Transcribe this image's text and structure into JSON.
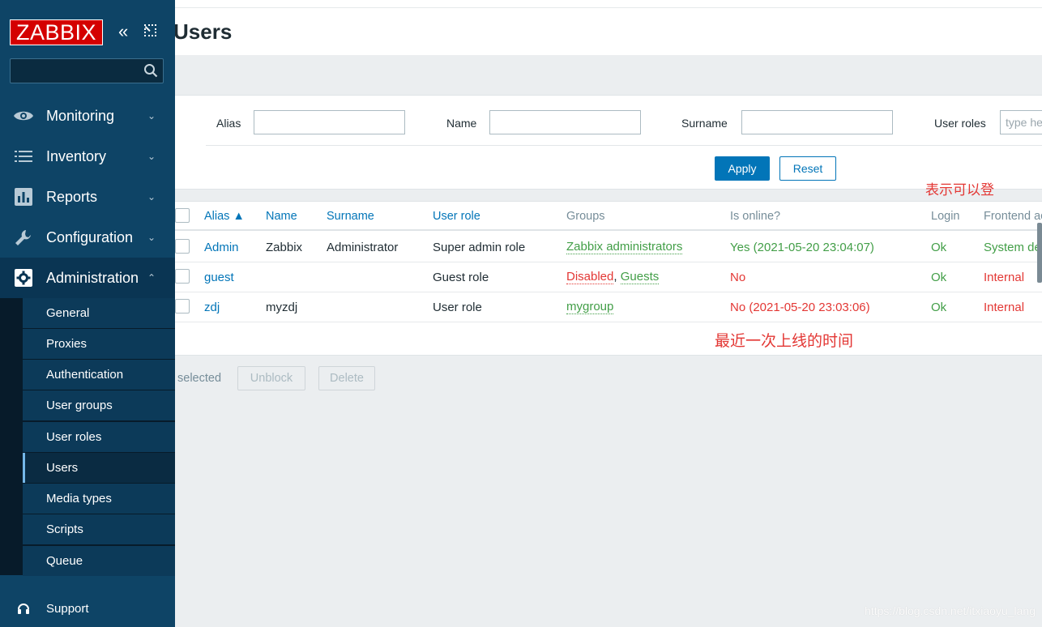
{
  "brand": {
    "logo_text": "ZABBIX",
    "logo_color": "#d40000"
  },
  "sidebar": {
    "search_placeholder": "",
    "menu": [
      {
        "label": "Monitoring",
        "icon": "eye-icon"
      },
      {
        "label": "Inventory",
        "icon": "list-icon"
      },
      {
        "label": "Reports",
        "icon": "bar-chart-icon"
      },
      {
        "label": "Configuration",
        "icon": "wrench-icon"
      },
      {
        "label": "Administration",
        "icon": "gear-icon"
      }
    ],
    "submenu": [
      "General",
      "Proxies",
      "Authentication",
      "User groups",
      "User roles",
      "Users",
      "Media types",
      "Scripts",
      "Queue"
    ],
    "support_label": "Support"
  },
  "page": {
    "title": "Users"
  },
  "filter": {
    "alias_label": "Alias",
    "name_label": "Name",
    "surname_label": "Surname",
    "user_roles_label": "User roles",
    "user_roles_placeholder": "type here to search",
    "alias_value": "",
    "name_value": "",
    "surname_value": "",
    "apply_label": "Apply",
    "reset_label": "Reset"
  },
  "table": {
    "headers": {
      "alias": "Alias ▲",
      "name": "Name",
      "surname": "Surname",
      "user_role": "User role",
      "groups": "Groups",
      "is_online": "Is online?",
      "login": "Login",
      "frontend": "Frontend access"
    },
    "rows": [
      {
        "alias": "Admin",
        "name": "Zabbix",
        "surname": "Administrator",
        "user_role": "Super admin role",
        "groups": [
          {
            "text": "Zabbix administrators",
            "status": "green"
          }
        ],
        "is_online": "Yes (2021-05-20 23:04:07)",
        "online_status": "green",
        "login": "Ok",
        "frontend": "System default",
        "frontend_status": "green"
      },
      {
        "alias": "guest",
        "name": "",
        "surname": "",
        "user_role": "Guest role",
        "groups": [
          {
            "text": "Disabled",
            "status": "red"
          },
          {
            "text": "Guests",
            "status": "green"
          }
        ],
        "is_online": "No",
        "online_status": "red",
        "login": "Ok",
        "frontend": "Internal",
        "frontend_status": "red"
      },
      {
        "alias": "zdj",
        "name": "myzdj",
        "surname": "",
        "user_role": "User role",
        "groups": [
          {
            "text": "mygroup",
            "status": "green"
          }
        ],
        "is_online": "No (2021-05-20 23:03:06)",
        "online_status": "red",
        "login": "Ok",
        "frontend": "Internal",
        "frontend_status": "red"
      }
    ],
    "group_separator": ","
  },
  "footer": {
    "selected_text": "selected",
    "unblock_label": "Unblock",
    "delete_label": "Delete"
  },
  "annotations": {
    "login_note": "表示可以登",
    "online_note": "最近一次上线的时间"
  },
  "watermark": "https://blog.csdn.net/itxiaoyu_lang",
  "colors": {
    "accent": "#0275b8",
    "ok_green": "#429e47",
    "alert_red": "#e33734",
    "sidebar": "#0e4466"
  }
}
